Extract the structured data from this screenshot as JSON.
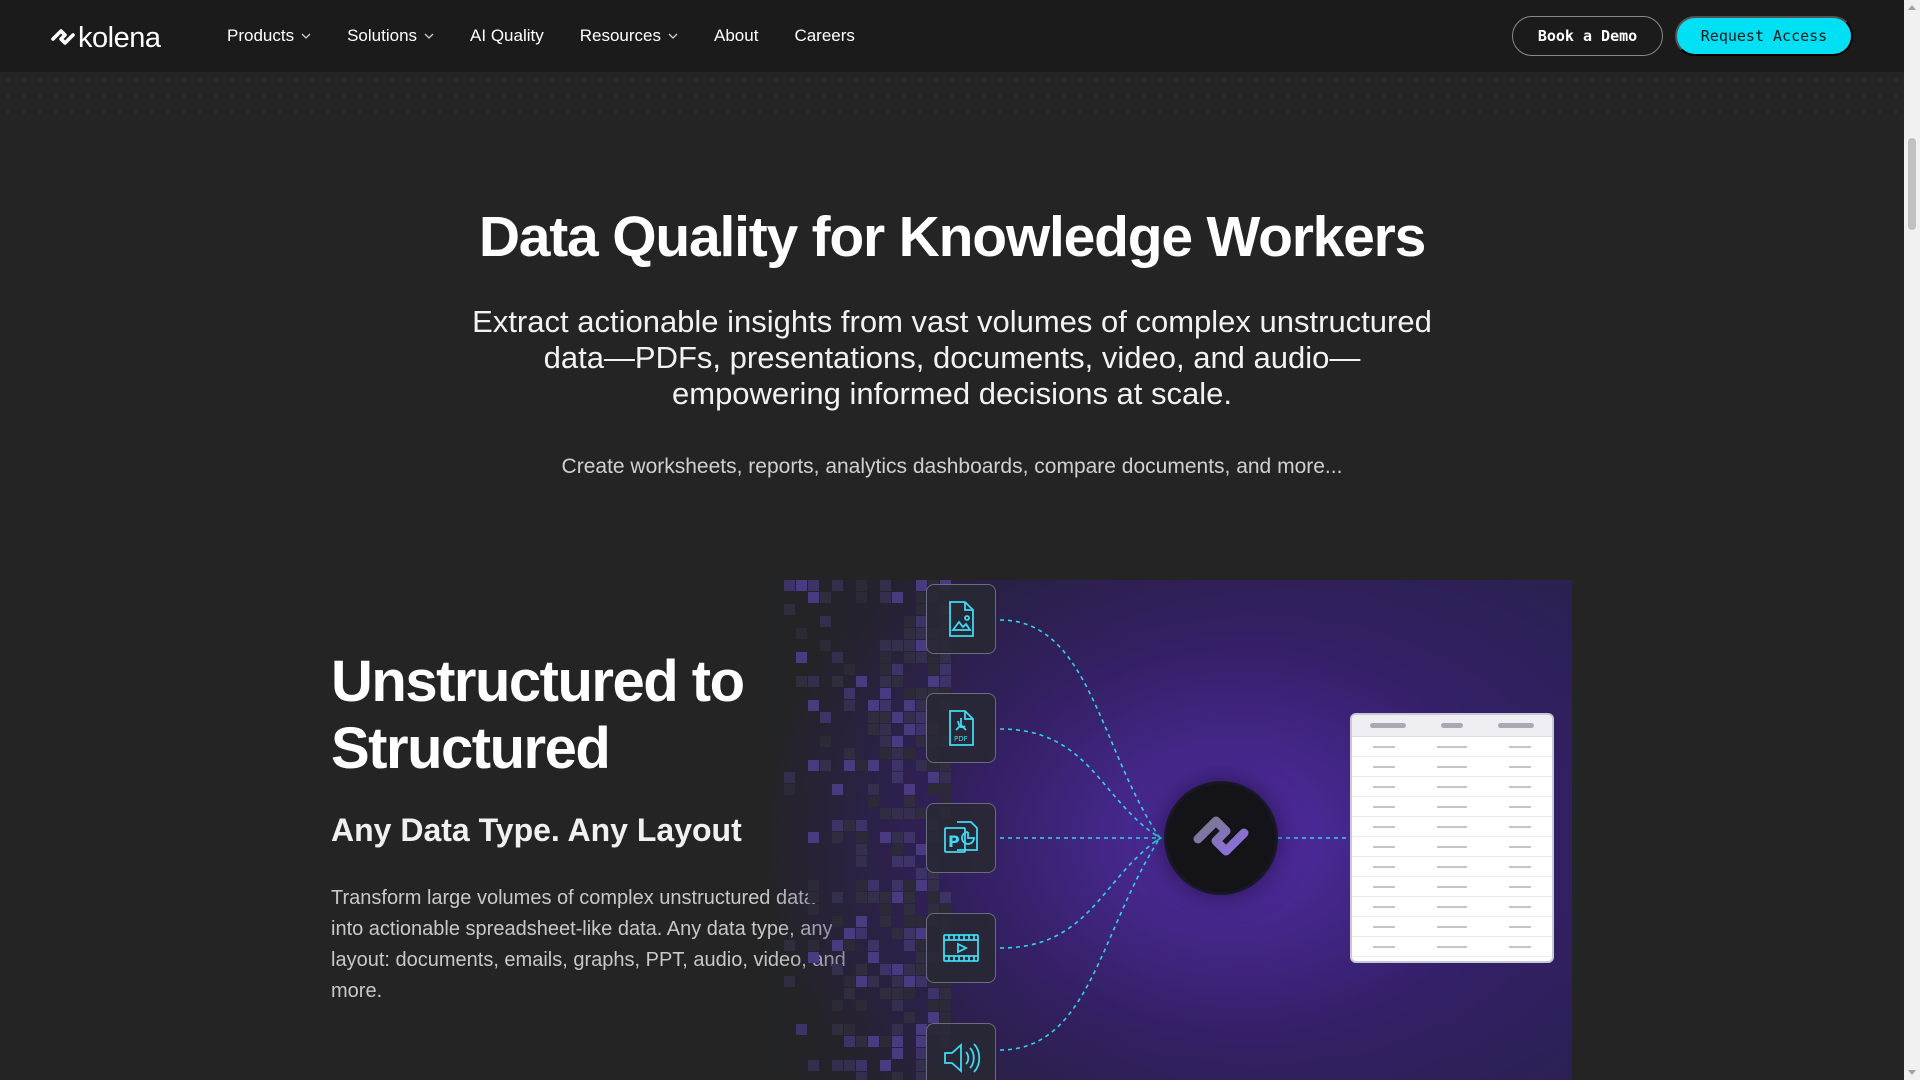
{
  "nav": {
    "logo_text": "kolena",
    "items": [
      {
        "label": "Products",
        "has_dropdown": true
      },
      {
        "label": "Solutions",
        "has_dropdown": true
      },
      {
        "label": "AI Quality",
        "has_dropdown": false
      },
      {
        "label": "Resources",
        "has_dropdown": true
      },
      {
        "label": "About",
        "has_dropdown": false
      },
      {
        "label": "Careers",
        "has_dropdown": false
      }
    ],
    "book_demo_label": "Book a Demo",
    "request_access_label": "Request Access"
  },
  "hero": {
    "title": "Data Quality for Knowledge Workers",
    "subtitle": "Extract actionable insights from vast volumes of complex unstructured data—PDFs, presentations, documents, video, and audio—empowering informed decisions at scale.",
    "tagline": "Create worksheets, reports, analytics dashboards, compare documents, and more..."
  },
  "feature": {
    "title_line1": "Unstructured to",
    "title_line2": "Structured",
    "subtitle": "Any Data Type. Any Layout",
    "description": "Transform large volumes of complex unstructured data into actionable spreadsheet-like data. Any data type, any layout: documents, emails, graphs, PPT, audio, video, and more.",
    "inputs": [
      {
        "icon": "image-document-icon"
      },
      {
        "icon": "pdf-document-icon",
        "text": "PDF"
      },
      {
        "icon": "powerpoint-document-icon",
        "text": "P"
      },
      {
        "icon": "video-file-icon"
      },
      {
        "icon": "audio-speaker-icon"
      }
    ],
    "hub_icon": "kolena-logo-icon",
    "output": "spreadsheet-table-icon"
  },
  "colors": {
    "background": "#232423",
    "navbar": "#1b1b1b",
    "accent": "#00e0f5",
    "connector": "#2fd3ee",
    "purple": "#6030c8"
  }
}
